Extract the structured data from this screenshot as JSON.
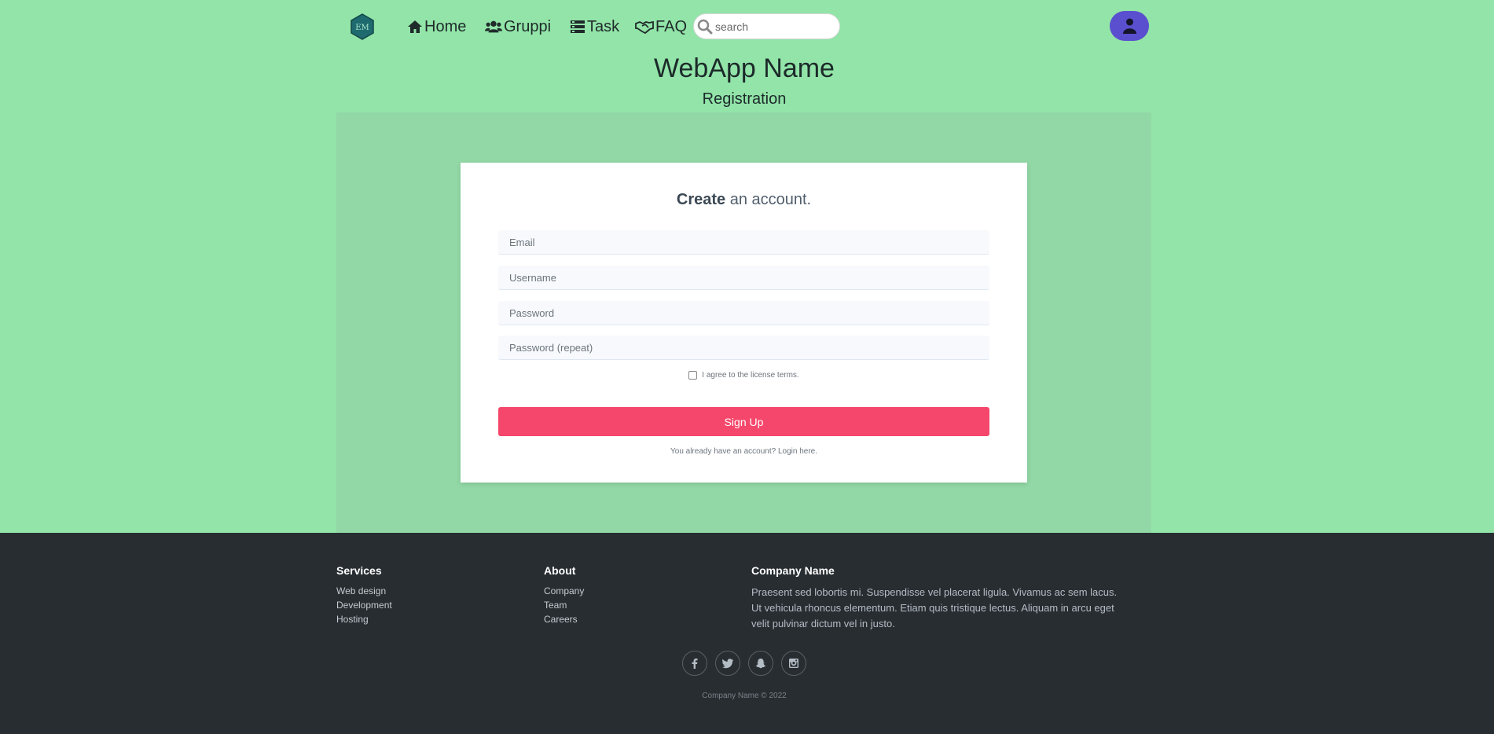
{
  "nav": {
    "logo_text": "EM",
    "items": [
      {
        "label": "Home",
        "icon": "home-icon"
      },
      {
        "label": "Gruppi",
        "icon": "users-icon"
      },
      {
        "label": "Task",
        "icon": "tasks-icon"
      },
      {
        "label": "FAQ",
        "icon": "handshake-icon"
      }
    ],
    "search": {
      "placeholder": "search",
      "icon": "search-icon"
    },
    "profile_icon": "user-icon"
  },
  "header": {
    "app_title": "WebApp Name",
    "page_subtitle": "Registration"
  },
  "form": {
    "title_bold": "Create",
    "title_rest": " an account.",
    "fields": [
      {
        "placeholder": "Email",
        "value": ""
      },
      {
        "placeholder": "Username",
        "value": ""
      },
      {
        "placeholder": "Password",
        "value": ""
      },
      {
        "placeholder": "Password (repeat)",
        "value": ""
      }
    ],
    "agree_label": "I agree to the license terms.",
    "agree_checked": false,
    "submit_label": "Sign Up",
    "login_text": "You already have an account? Login here."
  },
  "footer": {
    "services": {
      "title": "Services",
      "links": [
        "Web design",
        "Development",
        "Hosting"
      ]
    },
    "about": {
      "title": "About",
      "links": [
        "Company",
        "Team",
        "Careers"
      ]
    },
    "company": {
      "title": "Company Name",
      "text": "Praesent sed lobortis mi. Suspendisse vel placerat ligula. Vivamus ac sem lacus. Ut vehicula rhoncus elementum. Etiam quis tristique lectus. Aliquam in arcu eget velit pulvinar dictum vel in justo."
    },
    "socials": [
      "facebook-icon",
      "twitter-icon",
      "snapchat-icon",
      "instagram-icon"
    ],
    "copyright": "Company Name © 2022"
  },
  "colors": {
    "page_bg": "#92e4a8",
    "panel_bg": "#92d8a6",
    "accent": "#f4476b",
    "profile_button": "#5a4fcf",
    "footer_bg": "#282d32"
  }
}
